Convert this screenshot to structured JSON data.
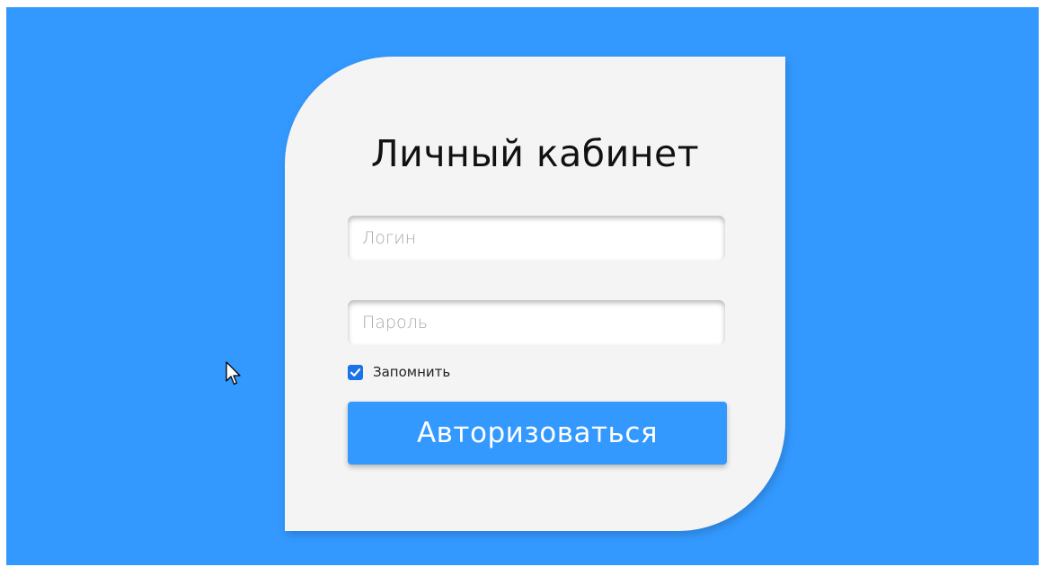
{
  "login_card": {
    "title": "Личный кабинет",
    "login_placeholder": "Логин",
    "password_placeholder": "Пароль",
    "remember_label": "Запомнить",
    "remember_checked": true,
    "submit_label": "Авторизоваться"
  },
  "colors": {
    "background": "#3399ff",
    "card": "#f4f4f4",
    "button": "#3399ff",
    "checkbox": "#1a73e8"
  },
  "icons": {
    "checkbox": "check-icon",
    "pointer": "mouse-pointer-icon"
  }
}
